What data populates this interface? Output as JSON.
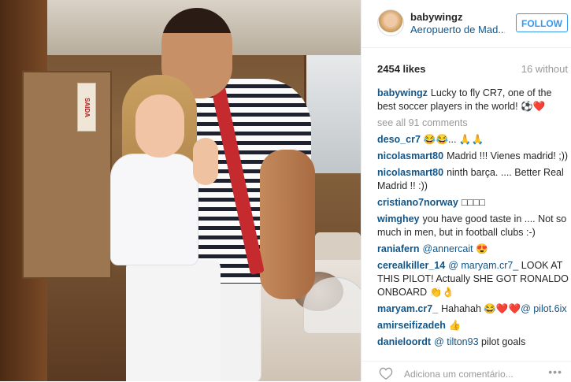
{
  "post": {
    "username": "babywingz",
    "location": "Aeropuerto de Mad...",
    "follow_label": "FOLLOW",
    "likes": "2454 likes",
    "time_ago": "16 without",
    "caption": {
      "user": "babywingz",
      "text": "Lucky to fly CR7, one of the best soccer players in the world! ⚽❤️"
    },
    "see_all": "see all 91 comments",
    "photo_sign": "SAIDA"
  },
  "comments": [
    {
      "user": "deso_cr7",
      "text": "😂😂... 🙏🙏"
    },
    {
      "user": "nicolasmart80",
      "text": "Madrid !!! Vienes madrid! ;))"
    },
    {
      "user": "nicolasmart80",
      "text": "ninth barça. .... Better Real Madrid !! :))"
    },
    {
      "user": "cristiano7norway",
      "text": "□□□□"
    },
    {
      "user": "wimghey",
      "text": "you have good taste in .... Not so much in men, but in football clubs :-)"
    },
    {
      "user": "raniafern",
      "mention": "@annercait",
      "text": "😍"
    },
    {
      "user": "cerealkiller_14",
      "mention": "@ maryam.cr7_",
      "text": "LOOK AT THIS PILOT! Actually SHE GOT RONALDO ONBOARD 👏👌"
    },
    {
      "user": "maryam.cr7_",
      "text": "Hahahah 😂❤️❤️",
      "mention": "@ pilot.6ix"
    },
    {
      "user": "amirseifizadeh",
      "text": "👍"
    },
    {
      "user": "danieloordt",
      "mention": "@ tilton93",
      "text": "pilot goals"
    }
  ],
  "add_comment_placeholder": "Adiciona um comentário...",
  "more_label": "•••",
  "colors": {
    "link": "#125688",
    "accent": "#3897f0",
    "muted": "#999999"
  }
}
